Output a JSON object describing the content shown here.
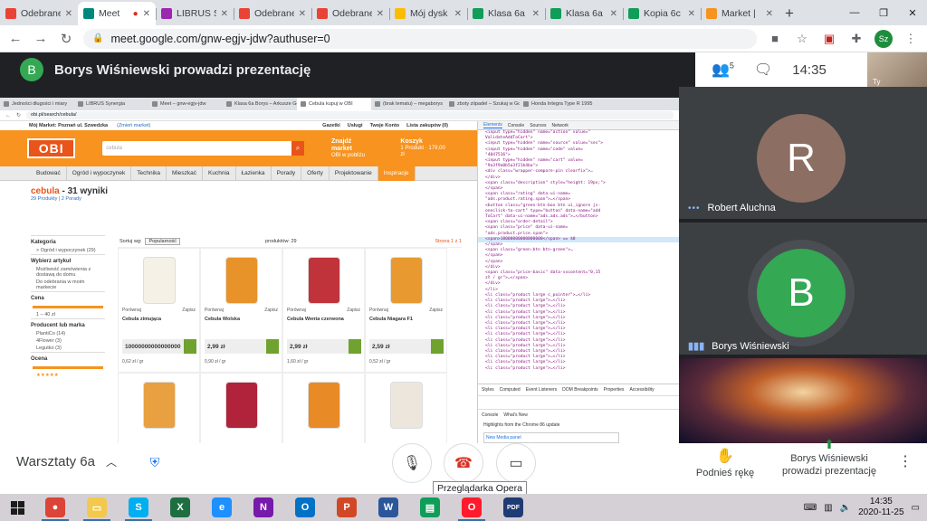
{
  "browser": {
    "tabs": [
      {
        "label": "Odebrane",
        "icon": "gmail-icon",
        "color": "#ea4335",
        "active": false
      },
      {
        "label": "Meet",
        "icon": "meet-icon",
        "color": "#00897b",
        "active": true
      },
      {
        "label": "LIBRUS Sy",
        "icon": "librus-icon",
        "color": "#9c27b0",
        "active": false
      },
      {
        "label": "Odebrane",
        "icon": "gmail-icon",
        "color": "#ea4335",
        "active": false
      },
      {
        "label": "Odebrane",
        "icon": "gmail-icon",
        "color": "#ea4335",
        "active": false
      },
      {
        "label": "Mój dysk",
        "icon": "drive-icon",
        "color": "#fbbc04",
        "active": false
      },
      {
        "label": "Klasa 6a",
        "icon": "sheets-icon",
        "color": "#0f9d58",
        "active": false
      },
      {
        "label": "Klasa 6a",
        "icon": "sheets-icon",
        "color": "#0f9d58",
        "active": false
      },
      {
        "label": "Kopia 6c",
        "icon": "sheets-icon",
        "color": "#0f9d58",
        "active": false
      },
      {
        "label": "Market |",
        "icon": "obi-icon",
        "color": "#f7931e",
        "active": false
      }
    ],
    "new_tab": "+",
    "url": "meet.google.com/gnw-egjv-jdw?authuser=0",
    "profile_initials": "Sz"
  },
  "meet": {
    "presenter_title": "Borys Wiśniewski prowadzi prezentację",
    "presenter_initial": "B",
    "participants_count": "5",
    "clock": "14:35",
    "self_initial": "Ty",
    "meeting_name": "Warsztaty 6a",
    "tooltip": "Przeglądarka Opera",
    "raise_hand": "Podnieś rękę",
    "presenting_now": "Borys Wiśniewski prowadzi prezentację",
    "participants": [
      {
        "initial": "R",
        "name": "Robert Aluchna",
        "color": "#8d6e63"
      },
      {
        "initial": "B",
        "name": "Borys Wiśniewski",
        "color": "#34a853"
      }
    ]
  },
  "shared": {
    "tabs": [
      "Jedności długości i miary",
      "LIBRUS Synergia",
      "Meet – gnw-egjv-jdw",
      "Klasa 6a Borys – Arkusze Go",
      "Cebula kupuj w OBI",
      "(brak tematu) – megaborys",
      "zboty ziipadel – Szukaj w Go",
      "Honda Integra Type R 1995"
    ],
    "url": "obi.pl/search/cebula/",
    "obi": {
      "market_label": "Mój Market: Poznań ul. Szwedzka",
      "change_market": "(Zmień market)",
      "top_links": [
        "Gazetki",
        "Usługi",
        "Twoje Konto",
        "Lista zakupów (0)"
      ],
      "logo": "OBI",
      "search_value": "cebula",
      "find_market": "Znajdź market",
      "find_market_sub": "OBI w pobliżu",
      "cart": "Koszyk",
      "cart_sub": "1 Produkt · 179,00 zł",
      "nav": [
        "Budować",
        "Ogród i wypoczynek",
        "Technika",
        "Mieszkać",
        "Kuchnia",
        "Łazienka",
        "Porady",
        "Oferty",
        "Projektowanie",
        "Inspiracje"
      ],
      "result_query": "cebula",
      "result_count": " - 31 wyniki",
      "result_sub": "29 Produkty | 2 Porady",
      "sidebar": {
        "category_head": "Kategoria",
        "category_item": "> Ogród i wypoczynek (29)",
        "choose_head": "Wybierz artykuł",
        "choose_items": [
          "Możliwość zamówienia z dostawą do domu",
          "Do odebrania w moim markecie"
        ],
        "price_head": "Cena",
        "price_from": "1",
        "price_to": "40 zł",
        "brand_head": "Producent lub marka",
        "brands": [
          "PlantiCo (14)",
          "4Flower (3)",
          "Legutko (3)"
        ],
        "rating_head": "Ocena"
      },
      "sort_label": "Sortuj wg:",
      "sort_value": "Popularność",
      "products_count": "produktów: 29",
      "page_label": "Strona 1 z 1",
      "compare": "Porównaj",
      "remember": "Zapisz",
      "products": [
        {
          "name": "Cebula zimująca",
          "price": "10000000000000000",
          "unit": "0,62 zł / gr",
          "color": "#f5f1e6"
        },
        {
          "name": "Cebula Wolska",
          "price": "2,99 zł",
          "unit": "0,90 zł / gr",
          "color": "#e8922a"
        },
        {
          "name": "Cebula Wenta czerwona",
          "price": "2,99 zł",
          "unit": "1,60 zł / gr",
          "color": "#c0333b"
        },
        {
          "name": "Cebula Niagara F1",
          "price": "2,59 zł",
          "unit": "0,52 zł / gr",
          "color": "#e89a30"
        }
      ],
      "products_row2_colors": [
        "#e8a040",
        "#b0233a",
        "#e88a25",
        "#ece6dc"
      ]
    },
    "devtools": {
      "tabs": [
        "Elements",
        "Console",
        "Sources",
        "Network"
      ],
      "lines": [
        "<input type=\"hidden\" name=\"action\" value=\"",
        "ValidateAddToCart\">",
        "<input type=\"hidden\" name=\"source\" value=\"ses\">",
        "<input type=\"hidden\" name=\"code\" value=",
        "\"4047516\">",
        "<input type=\"hidden\" name=\"cart\" value=",
        "\"9a3f9a0b5a3f21b4ba\">",
        "<div class=\"wrapper-compare-pin clearfix\">…",
        "</div>",
        "<span class=\"description\" style=\"height: 19px;\">",
        "</span>",
        "<span class=\"rating\" data-ui-name=",
        "\"ads.product.rating.span\">…</span>",
        "<button class=\"green-btn-box btn ui_ignore js-",
        "oneclick-to-cart\" type=\"button\" data-name=\"add",
        "ToCart\" data-ui-name=\"ads.ads.ads\">…</button>",
        "<span class=\"order-detail\">",
        "<span class=\"price\" data-ui-name=",
        "\"ads.product.price.span\">",
        "<span>10000000000000000</span> == $0",
        "</span>",
        "<span class=\"green-btn btn-green\">…",
        "</span>",
        "</span>",
        "</div>",
        "<span class=\"price-basic\" data-sxcontent=\"0,15",
        "zł / gr\">…</span>",
        "</div>",
        "</li>",
        "<li class=\"product large c_pointer\">…</li>",
        "<li class=\"product large\">…</li>",
        "<li class=\"product large\">…</li>",
        "<li class=\"product large\">…</li>",
        "<li class=\"product large\">…</li>",
        "<li class=\"product large\">…</li>",
        "<li class=\"product large\">…</li>",
        "<li class=\"product large\">…</li>",
        "<li class=\"product large\">…</li>",
        "<li class=\"product large\">…</li>",
        "<li class=\"product large\">…</li>",
        "<li class=\"product large\">…</li>",
        "<li class=\"product large\">…</li>",
        "<li class=\"product large\">…</li>"
      ],
      "highlight_index": 19,
      "bottom_tabs": [
        "Styles",
        "Computed",
        "Event Listeners",
        "DOM Breakpoints",
        "Properties",
        "Accessibility"
      ],
      "console_tabs": [
        "Console",
        "What's New"
      ],
      "console_line": "Highlights from the Chrome 86 update",
      "console_card": "New Media panel"
    }
  },
  "taskbar": {
    "apps": [
      {
        "icon": "chrome-icon",
        "color": "#db4437",
        "glyph": "●"
      },
      {
        "icon": "file-explorer-icon",
        "color": "#f2c94c",
        "glyph": "▭"
      },
      {
        "icon": "skype-icon",
        "color": "#00aff0",
        "glyph": "S"
      },
      {
        "icon": "excel-icon",
        "color": "#1d6f42",
        "glyph": "X"
      },
      {
        "icon": "internet-explorer-icon",
        "color": "#1e90ff",
        "glyph": "e"
      },
      {
        "icon": "onenote-icon",
        "color": "#7719aa",
        "glyph": "N"
      },
      {
        "icon": "outlook-icon",
        "color": "#0072c6",
        "glyph": "O"
      },
      {
        "icon": "powerpoint-icon",
        "color": "#d24726",
        "glyph": "P"
      },
      {
        "icon": "word-icon",
        "color": "#2b579a",
        "glyph": "W"
      },
      {
        "icon": "store-icon",
        "color": "#0f9d58",
        "glyph": "▤"
      },
      {
        "icon": "opera-icon",
        "color": "#ff1b2d",
        "glyph": "O"
      },
      {
        "icon": "pdf-icon",
        "color": "#1f3b73",
        "glyph": "PDF"
      }
    ],
    "time": "14:35",
    "date": "2020-11-25"
  }
}
